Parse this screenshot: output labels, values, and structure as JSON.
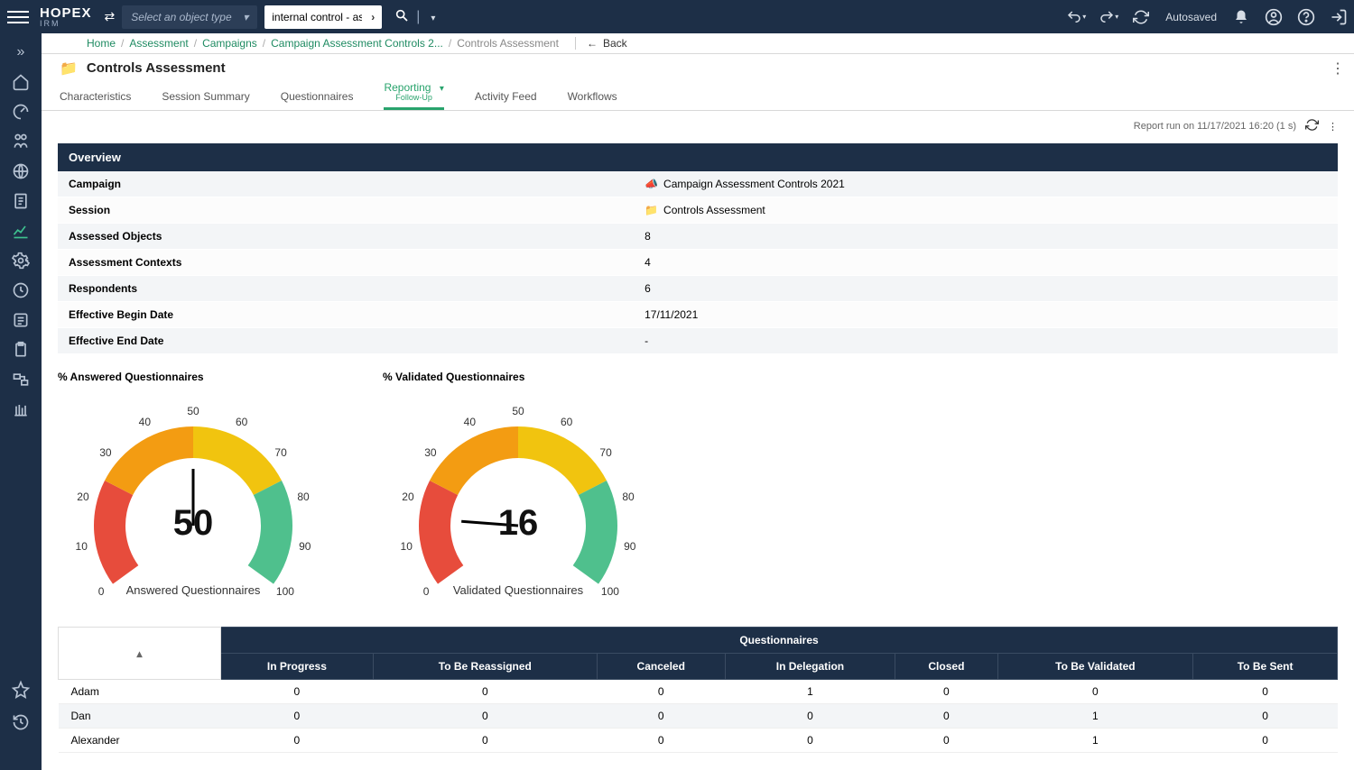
{
  "header": {
    "brand": "HOPEX",
    "brandSub": "IRM",
    "objectTypePlaceholder": "Select an object type",
    "searchValue": "internal control - asses",
    "autosaved": "Autosaved"
  },
  "breadcrumbs": {
    "items": [
      "Home",
      "Assessment",
      "Campaigns",
      "Campaign Assessment Controls 2..."
    ],
    "current": "Controls Assessment",
    "back": "Back"
  },
  "page": {
    "title": "Controls Assessment",
    "reportMeta": "Report run on 11/17/2021 16:20 (1 s)"
  },
  "tabs": [
    {
      "label": "Characteristics"
    },
    {
      "label": "Session Summary"
    },
    {
      "label": "Questionnaires"
    },
    {
      "label": "Reporting",
      "sub": "Follow-Up",
      "active": true,
      "chev": true
    },
    {
      "label": "Activity Feed"
    },
    {
      "label": "Workflows"
    }
  ],
  "overview": {
    "heading": "Overview",
    "rows": [
      {
        "key": "Campaign",
        "value": "Campaign Assessment Controls 2021",
        "icon": "campaign"
      },
      {
        "key": "Session",
        "value": "Controls Assessment",
        "icon": "folder"
      },
      {
        "key": "Assessed Objects",
        "value": "8"
      },
      {
        "key": "Assessment Contexts",
        "value": "4"
      },
      {
        "key": "Respondents",
        "value": "6"
      },
      {
        "key": "Effective Begin Date",
        "value": "17/11/2021"
      },
      {
        "key": "Effective End Date",
        "value": "-"
      }
    ]
  },
  "chart_data": [
    {
      "type": "gauge",
      "title": "% Answered Questionnaires",
      "value": 50,
      "min": 0,
      "max": 100,
      "ticks": [
        0,
        10,
        20,
        30,
        40,
        50,
        60,
        70,
        80,
        90,
        100
      ],
      "segments": [
        {
          "from": 0,
          "to": 25,
          "color": "#e74c3c"
        },
        {
          "from": 25,
          "to": 50,
          "color": "#f39c12"
        },
        {
          "from": 50,
          "to": 75,
          "color": "#f1c40f"
        },
        {
          "from": 75,
          "to": 100,
          "color": "#4fc08d"
        }
      ],
      "axis_label": "Answered Questionnaires"
    },
    {
      "type": "gauge",
      "title": "% Validated Questionnaires",
      "value": 16,
      "min": 0,
      "max": 100,
      "ticks": [
        0,
        10,
        20,
        30,
        40,
        50,
        60,
        70,
        80,
        90,
        100
      ],
      "segments": [
        {
          "from": 0,
          "to": 25,
          "color": "#e74c3c"
        },
        {
          "from": 25,
          "to": 50,
          "color": "#f39c12"
        },
        {
          "from": 50,
          "to": 75,
          "color": "#f1c40f"
        },
        {
          "from": 75,
          "to": 100,
          "color": "#4fc08d"
        }
      ],
      "axis_label": "Validated Questionnaires"
    }
  ],
  "questionnairesTable": {
    "heading": "Questionnaires",
    "nameColSortIcon": "▴",
    "columns": [
      "In Progress",
      "To Be Reassigned",
      "Canceled",
      "In Delegation",
      "Closed",
      "To Be Validated",
      "To Be Sent"
    ],
    "rows": [
      {
        "name": "Adam",
        "values": [
          0,
          0,
          0,
          1,
          0,
          0,
          0
        ]
      },
      {
        "name": "Dan",
        "values": [
          0,
          0,
          0,
          0,
          0,
          1,
          0
        ]
      },
      {
        "name": "Alexander",
        "values": [
          0,
          0,
          0,
          0,
          0,
          1,
          0
        ]
      }
    ]
  }
}
